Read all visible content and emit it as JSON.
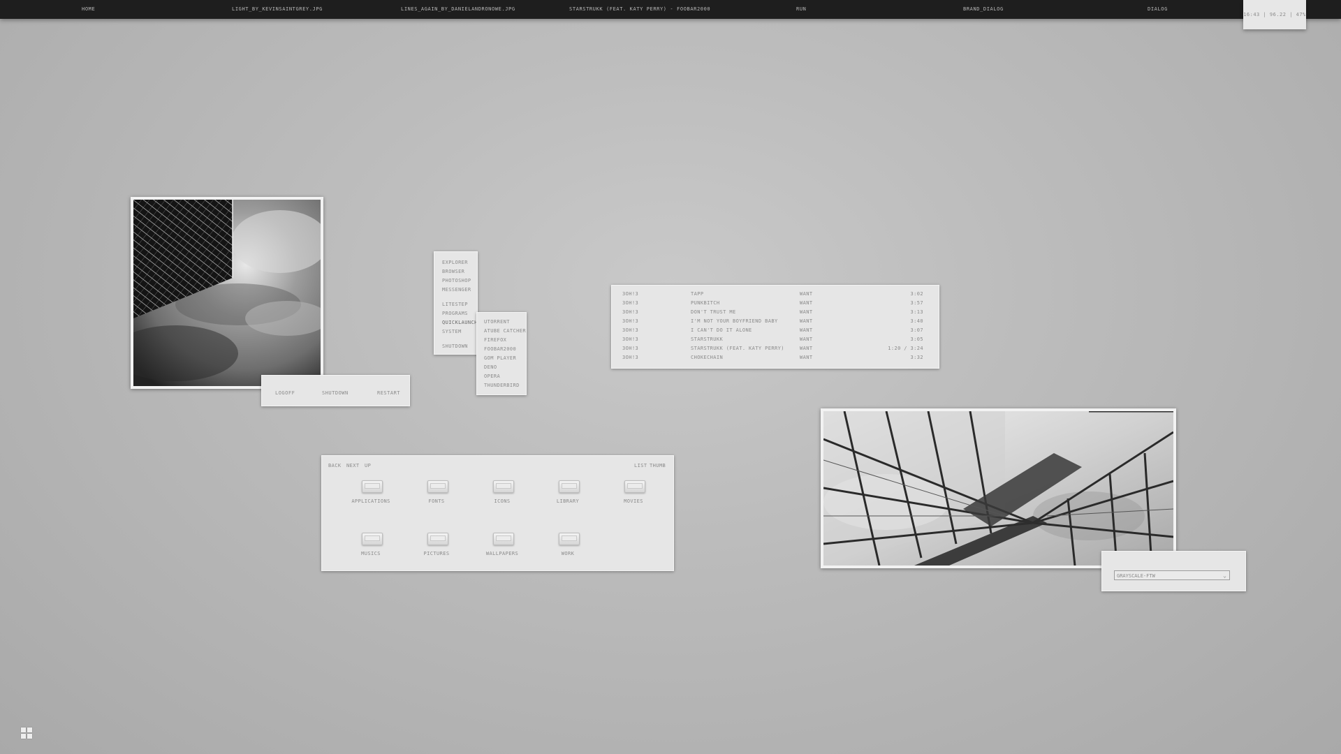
{
  "topbar": {
    "items": [
      {
        "label": "HOME"
      },
      {
        "label": "LIGHT_BY_KEVINSAINTGREY.JPG"
      },
      {
        "label": "LINES_AGAIN_BY_DANIELANDRONOWE.JPG"
      },
      {
        "label": "STARSTRUKK (FEAT. KATY PERRY) - FOOBAR2000"
      },
      {
        "label": "RUN"
      },
      {
        "label": "BRAND_DIALOG"
      },
      {
        "label": "DIALOG"
      }
    ],
    "clock": "16:43 | 96.22 | 47%"
  },
  "power": {
    "logoff": "LOGOFF",
    "shutdown": "SHUTDOWN",
    "restart": "RESTART"
  },
  "launcher": {
    "group1": [
      "EXPLORER",
      "BROWSER",
      "PHOTOSHOP",
      "MESSENGER"
    ],
    "group2": [
      "LITESTEP",
      "PROGRAMS",
      "QUICKLAUNCH >",
      "SYSTEM"
    ],
    "shutdown": "SHUTDOWN",
    "submenu": [
      "UTORRENT",
      "ATUBE CATCHER",
      "FIREFOX",
      "FOOBAR2000",
      "GOM PLAYER",
      "DENO",
      "OPERA",
      "THUNDERBIRD"
    ]
  },
  "playlist": {
    "rows": [
      {
        "artist": "3OH!3",
        "title": "TAPP",
        "album": "WANT",
        "time": "3:02"
      },
      {
        "artist": "3OH!3",
        "title": "PUNKBITCH",
        "album": "WANT",
        "time": "3:57"
      },
      {
        "artist": "3OH!3",
        "title": "DON'T TRUST ME",
        "album": "WANT",
        "time": "3:13"
      },
      {
        "artist": "3OH!3",
        "title": "I'M NOT YOUR BOYFRIEND BABY",
        "album": "WANT",
        "time": "3:40"
      },
      {
        "artist": "3OH!3",
        "title": "I CAN'T DO IT ALONE",
        "album": "WANT",
        "time": "3:07"
      },
      {
        "artist": "3OH!3",
        "title": "STARSTRUKK",
        "album": "WANT",
        "time": "3:05"
      },
      {
        "artist": "3OH!3",
        "title": "STARSTRUKK (FEAT. KATY PERRY)",
        "album": "WANT",
        "time": "1:20 / 3:24"
      },
      {
        "artist": "3OH!3",
        "title": "CHOKECHAIN",
        "album": "WANT",
        "time": "3:32"
      }
    ]
  },
  "filemanager": {
    "back": "BACK",
    "next": "NEXT",
    "up": "UP",
    "list": "LIST",
    "thumb": "THUMB",
    "folders": [
      {
        "label": "APPLICATIONS"
      },
      {
        "label": "FONTS"
      },
      {
        "label": "ICONS"
      },
      {
        "label": "LIBRARY"
      },
      {
        "label": "MOVIES"
      },
      {
        "label": "MUSICS"
      },
      {
        "label": "PICTURES"
      },
      {
        "label": "WALLPAPERS"
      },
      {
        "label": "WORK"
      }
    ]
  },
  "theme": {
    "selected": "GRAYSCALE-FTW"
  }
}
